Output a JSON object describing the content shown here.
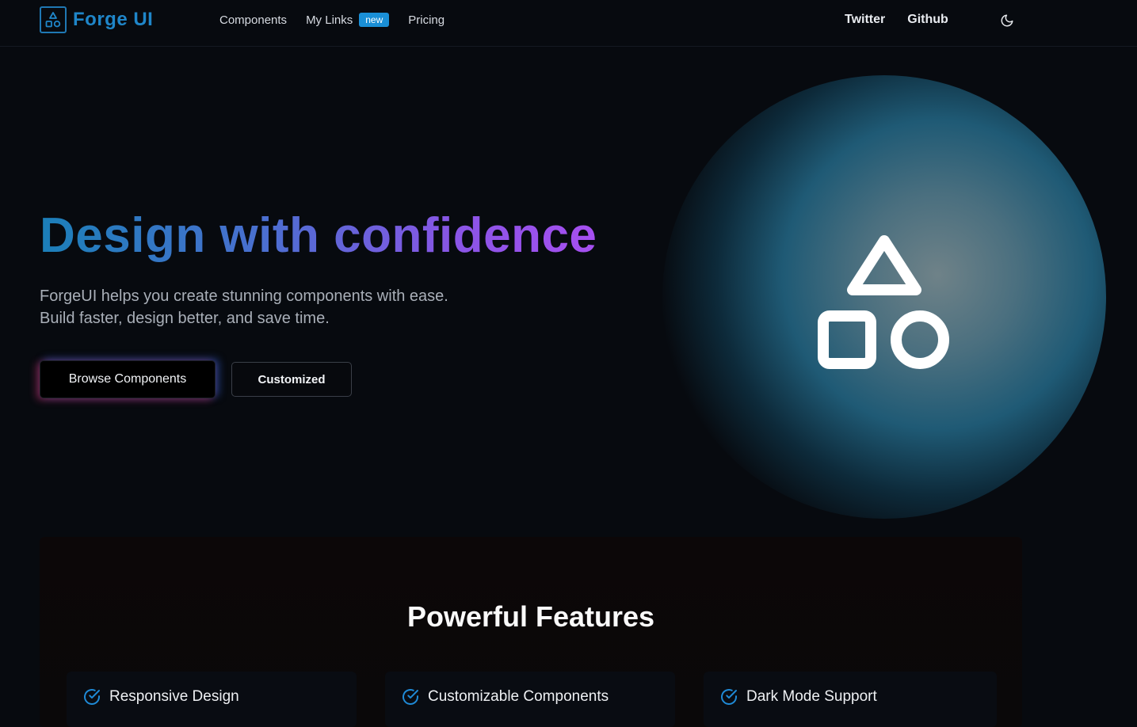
{
  "nav": {
    "brand": "Forge UI",
    "links": [
      {
        "label": "Components"
      },
      {
        "label": "My Links",
        "badge": "new"
      },
      {
        "label": "Pricing"
      }
    ],
    "external": [
      {
        "label": "Twitter"
      },
      {
        "label": "Github"
      }
    ],
    "theme_icon": "moon-icon"
  },
  "hero": {
    "title": "Design with confidence",
    "subtitle_line1": "ForgeUI helps you create stunning components with ease.",
    "subtitle_line2": "Build faster, design better, and save time.",
    "primary_button": "Browse Components",
    "secondary_button": "Customized",
    "icon": "shapes-icon"
  },
  "features": {
    "title": "Powerful Features",
    "items": [
      {
        "label": "Responsive Design",
        "icon": "check-circle-icon"
      },
      {
        "label": "Customizable Components",
        "icon": "check-circle-icon"
      },
      {
        "label": "Dark Mode Support",
        "icon": "check-circle-icon"
      }
    ]
  },
  "colors": {
    "brand": "#1f86c9",
    "badge": "#1a8fd6",
    "gradient_start": "#1b7fb8",
    "gradient_end": "#a64ff0",
    "background": "#070a0f"
  }
}
